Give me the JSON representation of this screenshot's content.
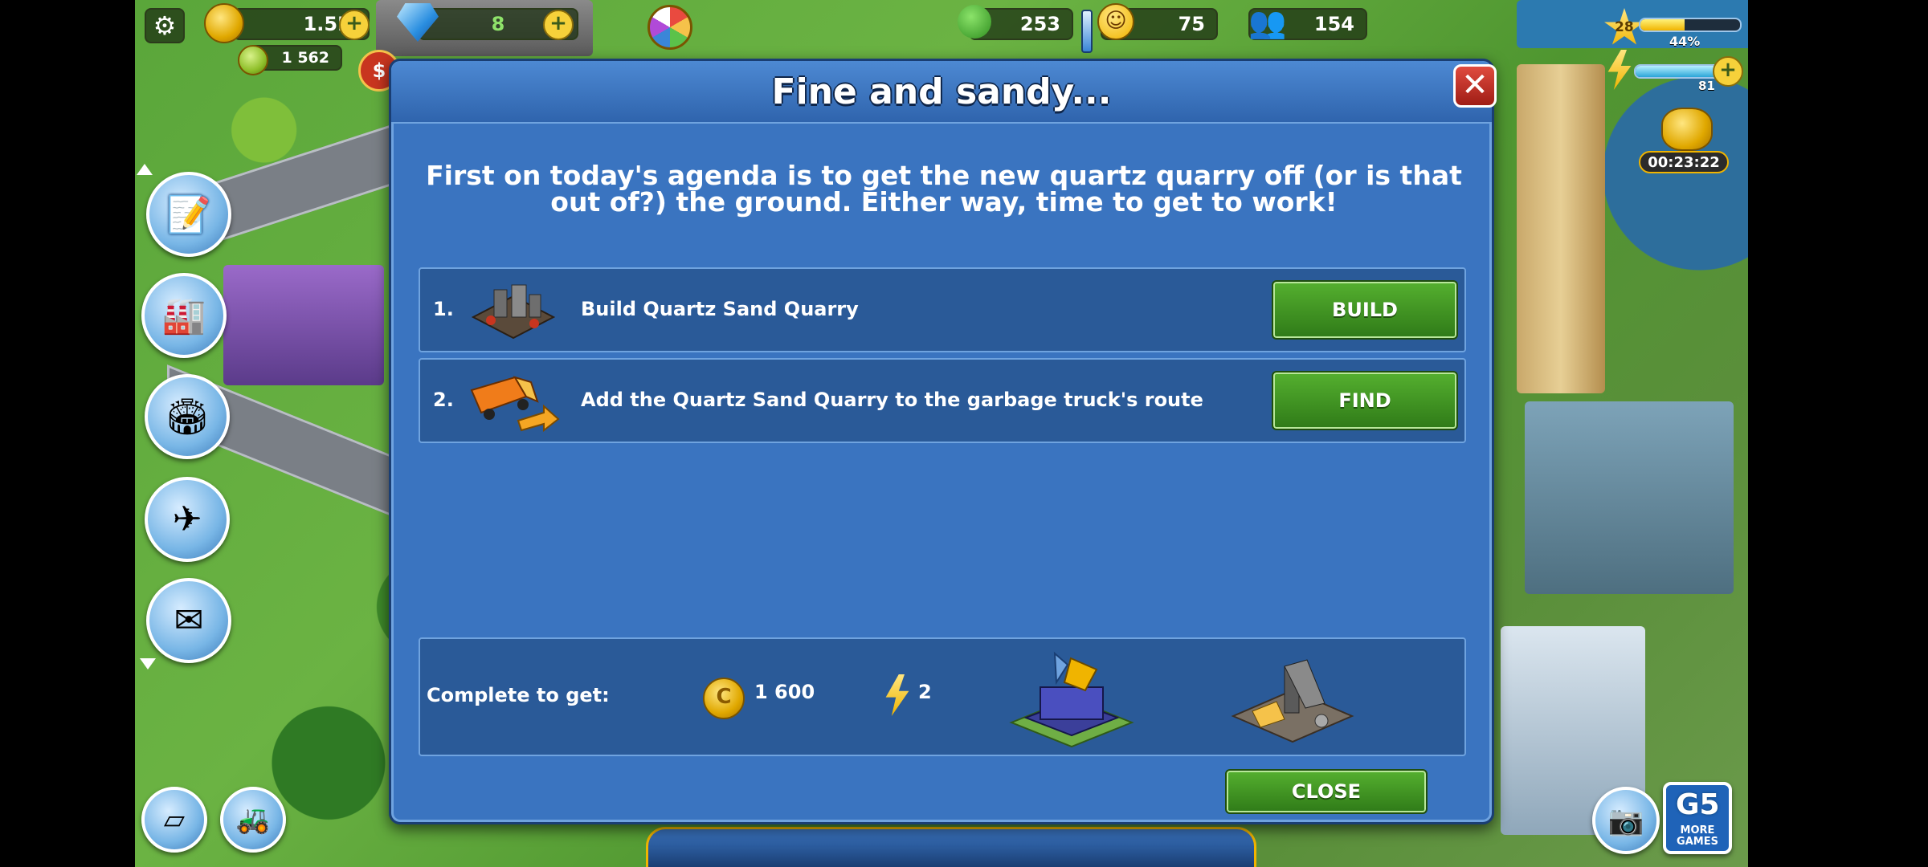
{
  "hud": {
    "coins": "1.5M",
    "cash": "1 562",
    "gems": "8",
    "trees": "253",
    "happiness": "75",
    "population": "154",
    "level": "28",
    "xp_percent_label": "44%",
    "xp_fraction": 0.44,
    "energy": "81",
    "energy_fraction": 0.85,
    "timer": "00:23:22"
  },
  "dialog": {
    "title": "Fine and sandy...",
    "intro": "First on today's agenda is to get the new quartz quarry off (or is that out of?) the ground. Either way, time to get to work!",
    "tasks": [
      {
        "number": "1.",
        "label": "Build Quartz Sand Quarry",
        "button": "BUILD",
        "icon": "quarry-icon"
      },
      {
        "number": "2.",
        "label": "Add the Quartz Sand Quarry to the garbage truck's route",
        "button": "FIND",
        "icon": "garbage-truck-icon"
      }
    ],
    "reward": {
      "label": "Complete to get:",
      "coins": "1 600",
      "energy": "2"
    },
    "close_button": "CLOSE"
  },
  "side_buttons": [
    "g5-notepad-icon",
    "factory-icon",
    "stadium-icon",
    "airport-icon",
    "g5-mail-icon"
  ],
  "bottom_right": {
    "more_games": "MORE GAMES"
  },
  "brand": {
    "g5": "G5"
  },
  "colors": {
    "dialog_bg": "#3a74c0",
    "panel_bg": "#2a5a98",
    "button_green": "#3f9423",
    "close_red": "#c0322a"
  }
}
